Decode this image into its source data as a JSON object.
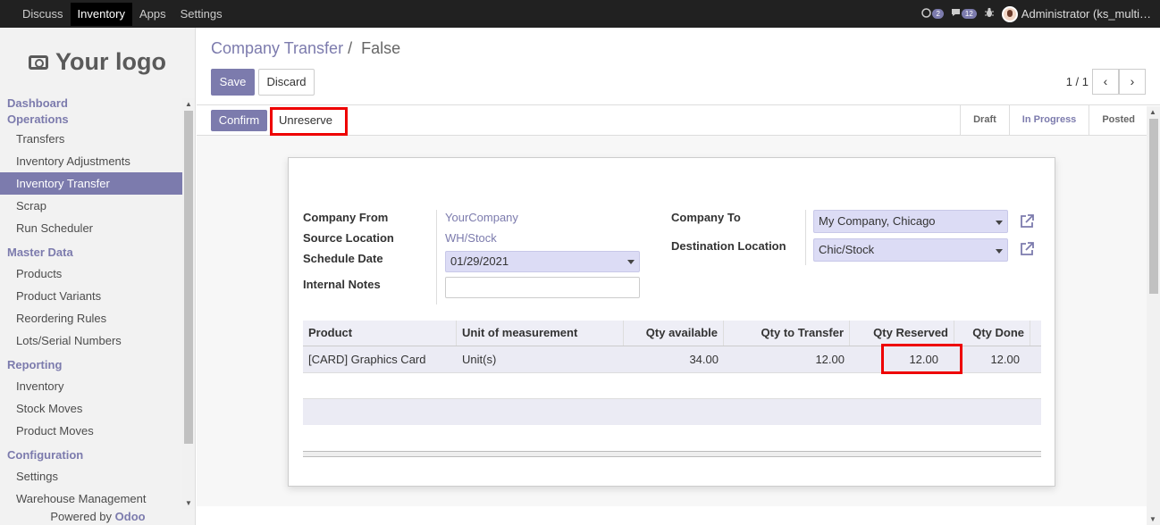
{
  "topbar": {
    "menu": [
      "Discuss",
      "Inventory",
      "Apps",
      "Settings"
    ],
    "active": "Inventory",
    "chat_count": "2",
    "activity_count": "12",
    "user": "Administrator (ks_multi…"
  },
  "sidebar": {
    "logo_text": "Your logo",
    "sections": [
      {
        "title": "Dashboard",
        "items": []
      },
      {
        "title": "Operations",
        "items": [
          "Transfers",
          "Inventory Adjustments",
          "Inventory Transfer",
          "Scrap",
          "Run Scheduler"
        ]
      },
      {
        "title": "Master Data",
        "items": [
          "Products",
          "Product Variants",
          "Reordering Rules",
          "Lots/Serial Numbers"
        ]
      },
      {
        "title": "Reporting",
        "items": [
          "Inventory",
          "Stock Moves",
          "Product Moves"
        ]
      },
      {
        "title": "Configuration",
        "items": [
          "Settings",
          "Warehouse Management"
        ]
      }
    ],
    "active_item": "Inventory Transfer",
    "powered_prefix": "Powered by",
    "powered_brand": "Odoo"
  },
  "breadcrumb": {
    "parent": "Company Transfer",
    "separator": "/",
    "current": "False"
  },
  "buttons": {
    "save": "Save",
    "discard": "Discard",
    "confirm": "Confirm",
    "unreserve": "Unreserve"
  },
  "pager": {
    "value": "1 / 1",
    "prev": "‹",
    "next": "›"
  },
  "stages": [
    "Draft",
    "In Progress",
    "Posted"
  ],
  "current_stage": "In Progress",
  "form": {
    "company_from_label": "Company From",
    "company_from": "YourCompany",
    "source_location_label": "Source Location",
    "source_location": "WH/Stock",
    "schedule_date_label": "Schedule Date",
    "schedule_date": "01/29/2021",
    "internal_notes_label": "Internal Notes",
    "internal_notes": "",
    "company_to_label": "Company To",
    "company_to": "My Company, Chicago",
    "destination_location_label": "Destination Location",
    "destination_location": "Chic/Stock"
  },
  "table": {
    "headers": [
      "Product",
      "Unit of measurement",
      "Qty available",
      "Qty to Transfer",
      "Qty Reserved",
      "Qty Done"
    ],
    "rows": [
      [
        "[CARD] Graphics Card",
        "Unit(s)",
        "34.00",
        "12.00",
        "12.00",
        "12.00"
      ]
    ]
  }
}
